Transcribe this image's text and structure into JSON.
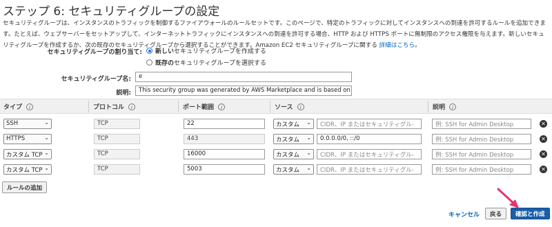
{
  "title": "ステップ 6: セキュリティグループの設定",
  "description": {
    "text": "セキュリティグループは、インスタンスのトラフィックを制御するファイアウォールのルールセットです。このページで、特定のトラフィックに対してインスタンスへの到達を許可するルールを追加できます。たとえば、ウェブサーバーをセットアップして、インターネットトラフィックにインスタンスへの到達を許可する場合、HTTP および HTTPS ポートに無制限のアクセス権限を与えます。新しいセキュリティグループを作成するか、次の既存のセキュリティグループから選択することができます。Amazon EC2 セキュリティグループに関する",
    "link": "詳細はこちら",
    "suffix": "。"
  },
  "assignment": {
    "label": "セキュリティグループの割り当て:",
    "options": [
      {
        "bold": "新しい",
        "rest": "セキュリティグループを作成する",
        "checked": true
      },
      {
        "bold": "既存の",
        "rest": "セキュリティグループを選択する",
        "checked": false
      }
    ]
  },
  "group_name": {
    "label": "セキュリティグループ名:",
    "value": "e"
  },
  "group_desc": {
    "label": "説明:",
    "value": "This security group was generated by AWS Marketplace and is based on recomi"
  },
  "table": {
    "headers": {
      "type": "タイプ",
      "protocol": "プロトコル",
      "port": "ポート範囲",
      "source": "ソース",
      "description": "説明"
    },
    "info_symbol": "i",
    "remove_symbol": "✕",
    "rows": [
      {
        "type": "SSH",
        "protocol": "TCP",
        "port": "22",
        "source": "カスタム",
        "cidr": "CIDR、IP またはセキュリティグル‐",
        "cidr_placeholder": true,
        "desc": "例: SSH for Admin Desktop"
      },
      {
        "type": "HTTPS",
        "protocol": "TCP",
        "port": "443",
        "source": "カスタム",
        "cidr": "0.0.0.0/0, ::/0",
        "cidr_placeholder": false,
        "desc": "例: SSH for Admin Desktop"
      },
      {
        "type": "カスタム TCP",
        "protocol": "TCP",
        "port": "16000",
        "source": "カスタム",
        "cidr": "CIDR、IP またはセキュリティグル‐",
        "cidr_placeholder": true,
        "desc": "例: SSH for Admin Desktop"
      },
      {
        "type": "カスタム TCP",
        "protocol": "TCP",
        "port": "5003",
        "source": "カスタム",
        "cidr": "CIDR、IP またはセキュリティグル‐",
        "cidr_placeholder": true,
        "desc": "例: SSH for Admin Desktop"
      }
    ]
  },
  "buttons": {
    "add_rule": "ルールの追加",
    "cancel": "キャンセル",
    "back": "戻る",
    "confirm": "確認と作成"
  },
  "colors": {
    "primary": "#1a5ea8",
    "link": "#0066c0",
    "arrow": "#e8336d"
  },
  "icons": {
    "select": "chevron-down-icon",
    "info": "info-icon",
    "remove": "remove-circle-icon",
    "arrow": "pointer-arrow-icon"
  }
}
